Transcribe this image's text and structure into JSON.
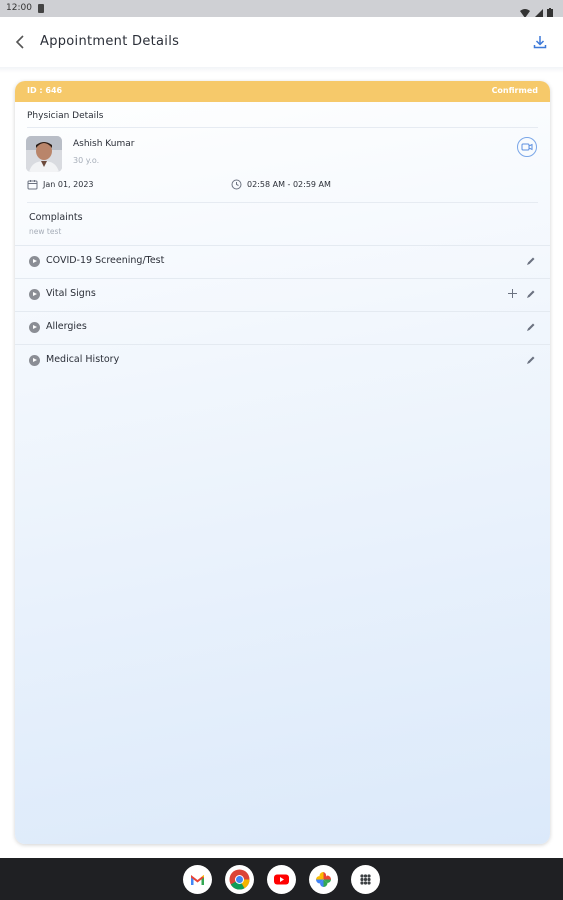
{
  "status_bar": {
    "time": "12:00"
  },
  "header": {
    "title": "Appointment Details"
  },
  "appointment": {
    "id_label": "ID : 646",
    "status": "Confirmed",
    "section_title": "Physician Details",
    "physician": {
      "name": "Ashish Kumar",
      "age": "30 y.o."
    },
    "date": "Jan 01, 2023",
    "time": "02:58 AM - 02:59 AM",
    "complaints_label": "Complaints",
    "complaints_text": "new test"
  },
  "sections": [
    {
      "label": "COVID-19 Screening/Test"
    },
    {
      "label": "Vital Signs"
    },
    {
      "label": "Allergies"
    },
    {
      "label": "Medical History"
    }
  ],
  "colors": {
    "accent": "#f6c96a",
    "icon_blue": "#3d79d8"
  },
  "dock_apps": [
    "gmail-icon",
    "chrome-icon",
    "youtube-icon",
    "photos-icon",
    "app-drawer-icon"
  ]
}
